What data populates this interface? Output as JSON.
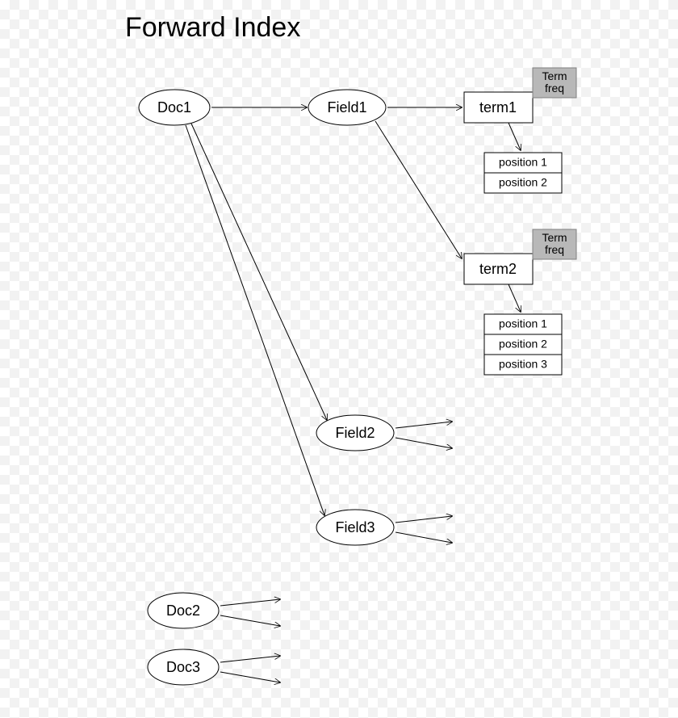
{
  "title": "Forward Index",
  "nodes": {
    "doc1": "Doc1",
    "doc2": "Doc2",
    "doc3": "Doc3",
    "field1": "Field1",
    "field2": "Field2",
    "field3": "Field3",
    "term1": "term1",
    "term2": "term2",
    "termfreq1a": "Term",
    "termfreq1b": "freq",
    "termfreq2a": "Term",
    "termfreq2b": "freq",
    "t1_pos1": "position 1",
    "t1_pos2": "position 2",
    "t2_pos1": "position 1",
    "t2_pos2": "position 2",
    "t2_pos3": "position 3"
  }
}
